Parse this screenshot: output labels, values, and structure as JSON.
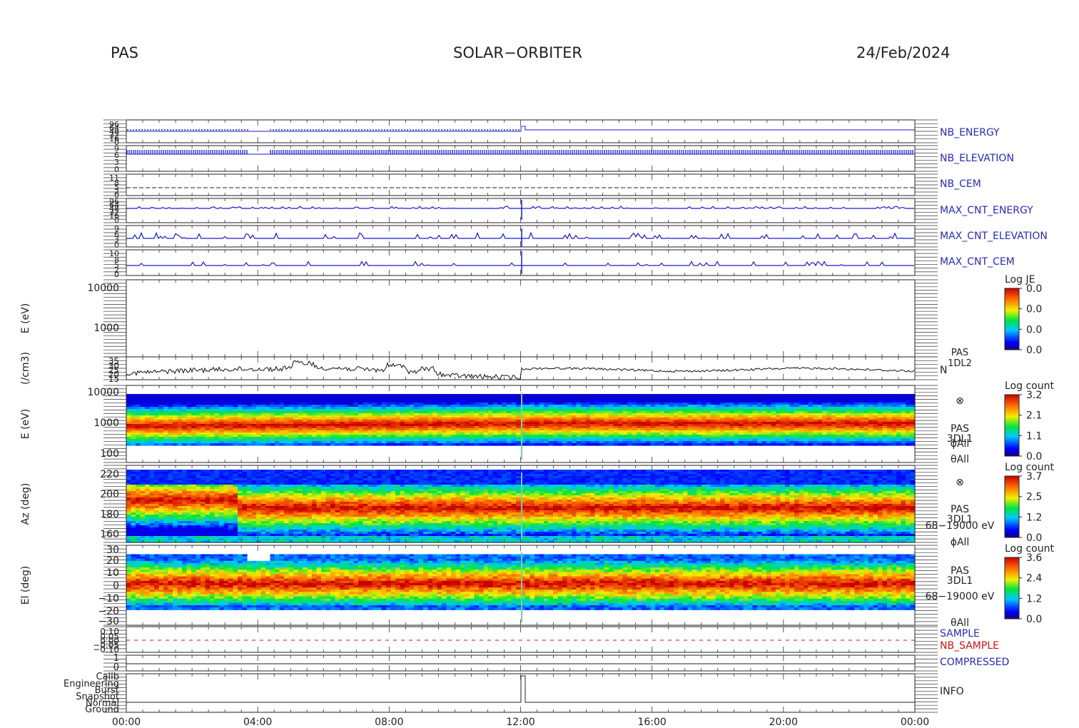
{
  "header": {
    "left": "PAS",
    "center": "SOLAR−ORBITER",
    "right": "24/Feb/2024"
  },
  "colors": {
    "trace_blue": "#1a1ad0",
    "label_blue": "#2a2ab8",
    "label_red": "#d01010"
  },
  "chart_data": {
    "type": "multi-panel time series and spectrograms",
    "x_tick_labels": [
      "00:00",
      "04:00",
      "08:00",
      "12:00",
      "16:00",
      "20:00",
      "00:00"
    ],
    "panels": [
      {
        "id": "nb_energy",
        "type": "line",
        "label": "NB_ENERGY",
        "ytick_labels": [
          "96",
          "64",
          "48",
          "32",
          "16",
          "0"
        ]
      },
      {
        "id": "nb_elevation",
        "type": "line",
        "label": "NB_ELEVATION",
        "ytick_labels": [
          "9",
          "6",
          "3",
          "0"
        ]
      },
      {
        "id": "nb_cem",
        "type": "line",
        "label": "NB_CEM",
        "ytick_labels": [
          "11",
          "8",
          "5",
          "2",
          "0"
        ]
      },
      {
        "id": "max_cnt_energy",
        "type": "line",
        "label": "MAX_CNT_ENERGY",
        "ytick_labels": [
          "96",
          "64",
          "48",
          "32",
          "16",
          "0"
        ]
      },
      {
        "id": "max_cnt_elevation",
        "type": "line",
        "label": "MAX_CNT_ELEVATION",
        "ytick_labels": [
          "9",
          "6",
          "3",
          "0"
        ]
      },
      {
        "id": "max_cnt_cem",
        "type": "line",
        "label": "MAX_CNT_CEM",
        "ytick_labels": [
          "10",
          "8",
          "5",
          "2",
          "0"
        ]
      },
      {
        "id": "je",
        "type": "heatmap",
        "ylabel": "E (eV)",
        "ytick_labels": [
          "10000",
          "1000"
        ],
        "colorbar": {
          "title": "Log JE",
          "ticks": [
            "0.0",
            "0.0",
            "0.0",
            "0.0"
          ]
        }
      },
      {
        "id": "density",
        "type": "line",
        "ylabel": "(/cm3)",
        "ytick_labels": [
          "35",
          "30",
          "25",
          "20",
          "15"
        ],
        "right_labels": [
          "PAS",
          "1DL2",
          "N"
        ],
        "ylim": [
          15,
          35
        ]
      },
      {
        "id": "espec",
        "type": "heatmap",
        "ylabel": "E (eV)",
        "ytick_labels": [
          "10000",
          "1000",
          "100"
        ],
        "right_labels": [
          "⊗",
          "PAS",
          "3DL1",
          "ϕAll",
          "θAll"
        ],
        "colorbar": {
          "title": "Log count",
          "ticks": [
            "3.2",
            "2.1",
            "1.1",
            "0.0"
          ]
        }
      },
      {
        "id": "az",
        "type": "heatmap",
        "ylabel": "Az (deg)",
        "ytick_labels": [
          "220",
          "200",
          "180",
          "160"
        ],
        "right_labels": [
          "⊗",
          "PAS",
          "3DL1",
          "68−19000 eV",
          "ϕAll"
        ],
        "colorbar": {
          "title": "Log count",
          "ticks": [
            "3.7",
            "2.5",
            "1.2",
            "0.0"
          ]
        }
      },
      {
        "id": "el",
        "type": "heatmap",
        "ylabel": "El (deg)",
        "ytick_labels": [
          "30",
          "20",
          "10",
          "0",
          "−10",
          "−20",
          "−30"
        ],
        "right_labels": [
          "PAS",
          "3DL1",
          "68−19000 eV",
          "θAll"
        ],
        "colorbar": {
          "title": "Log count",
          "ticks": [
            "3.6",
            "2.4",
            "1.2",
            "0.0"
          ]
        }
      },
      {
        "id": "sample",
        "type": "line",
        "labels": [
          "SAMPLE",
          "NB_SAMPLE"
        ],
        "ytick_labels": [
          "0.10",
          "0.05",
          "0.00",
          "−0.05",
          "−0.10"
        ]
      },
      {
        "id": "compressed",
        "type": "line",
        "label": "COMPRESSED",
        "ytick_labels": [
          "1",
          "0"
        ]
      },
      {
        "id": "info",
        "type": "step",
        "label": "INFO",
        "ytick_labels": [
          "Calib",
          "Engineering",
          "Burst",
          "Snapshot",
          "Normal",
          "Ground"
        ]
      }
    ]
  }
}
